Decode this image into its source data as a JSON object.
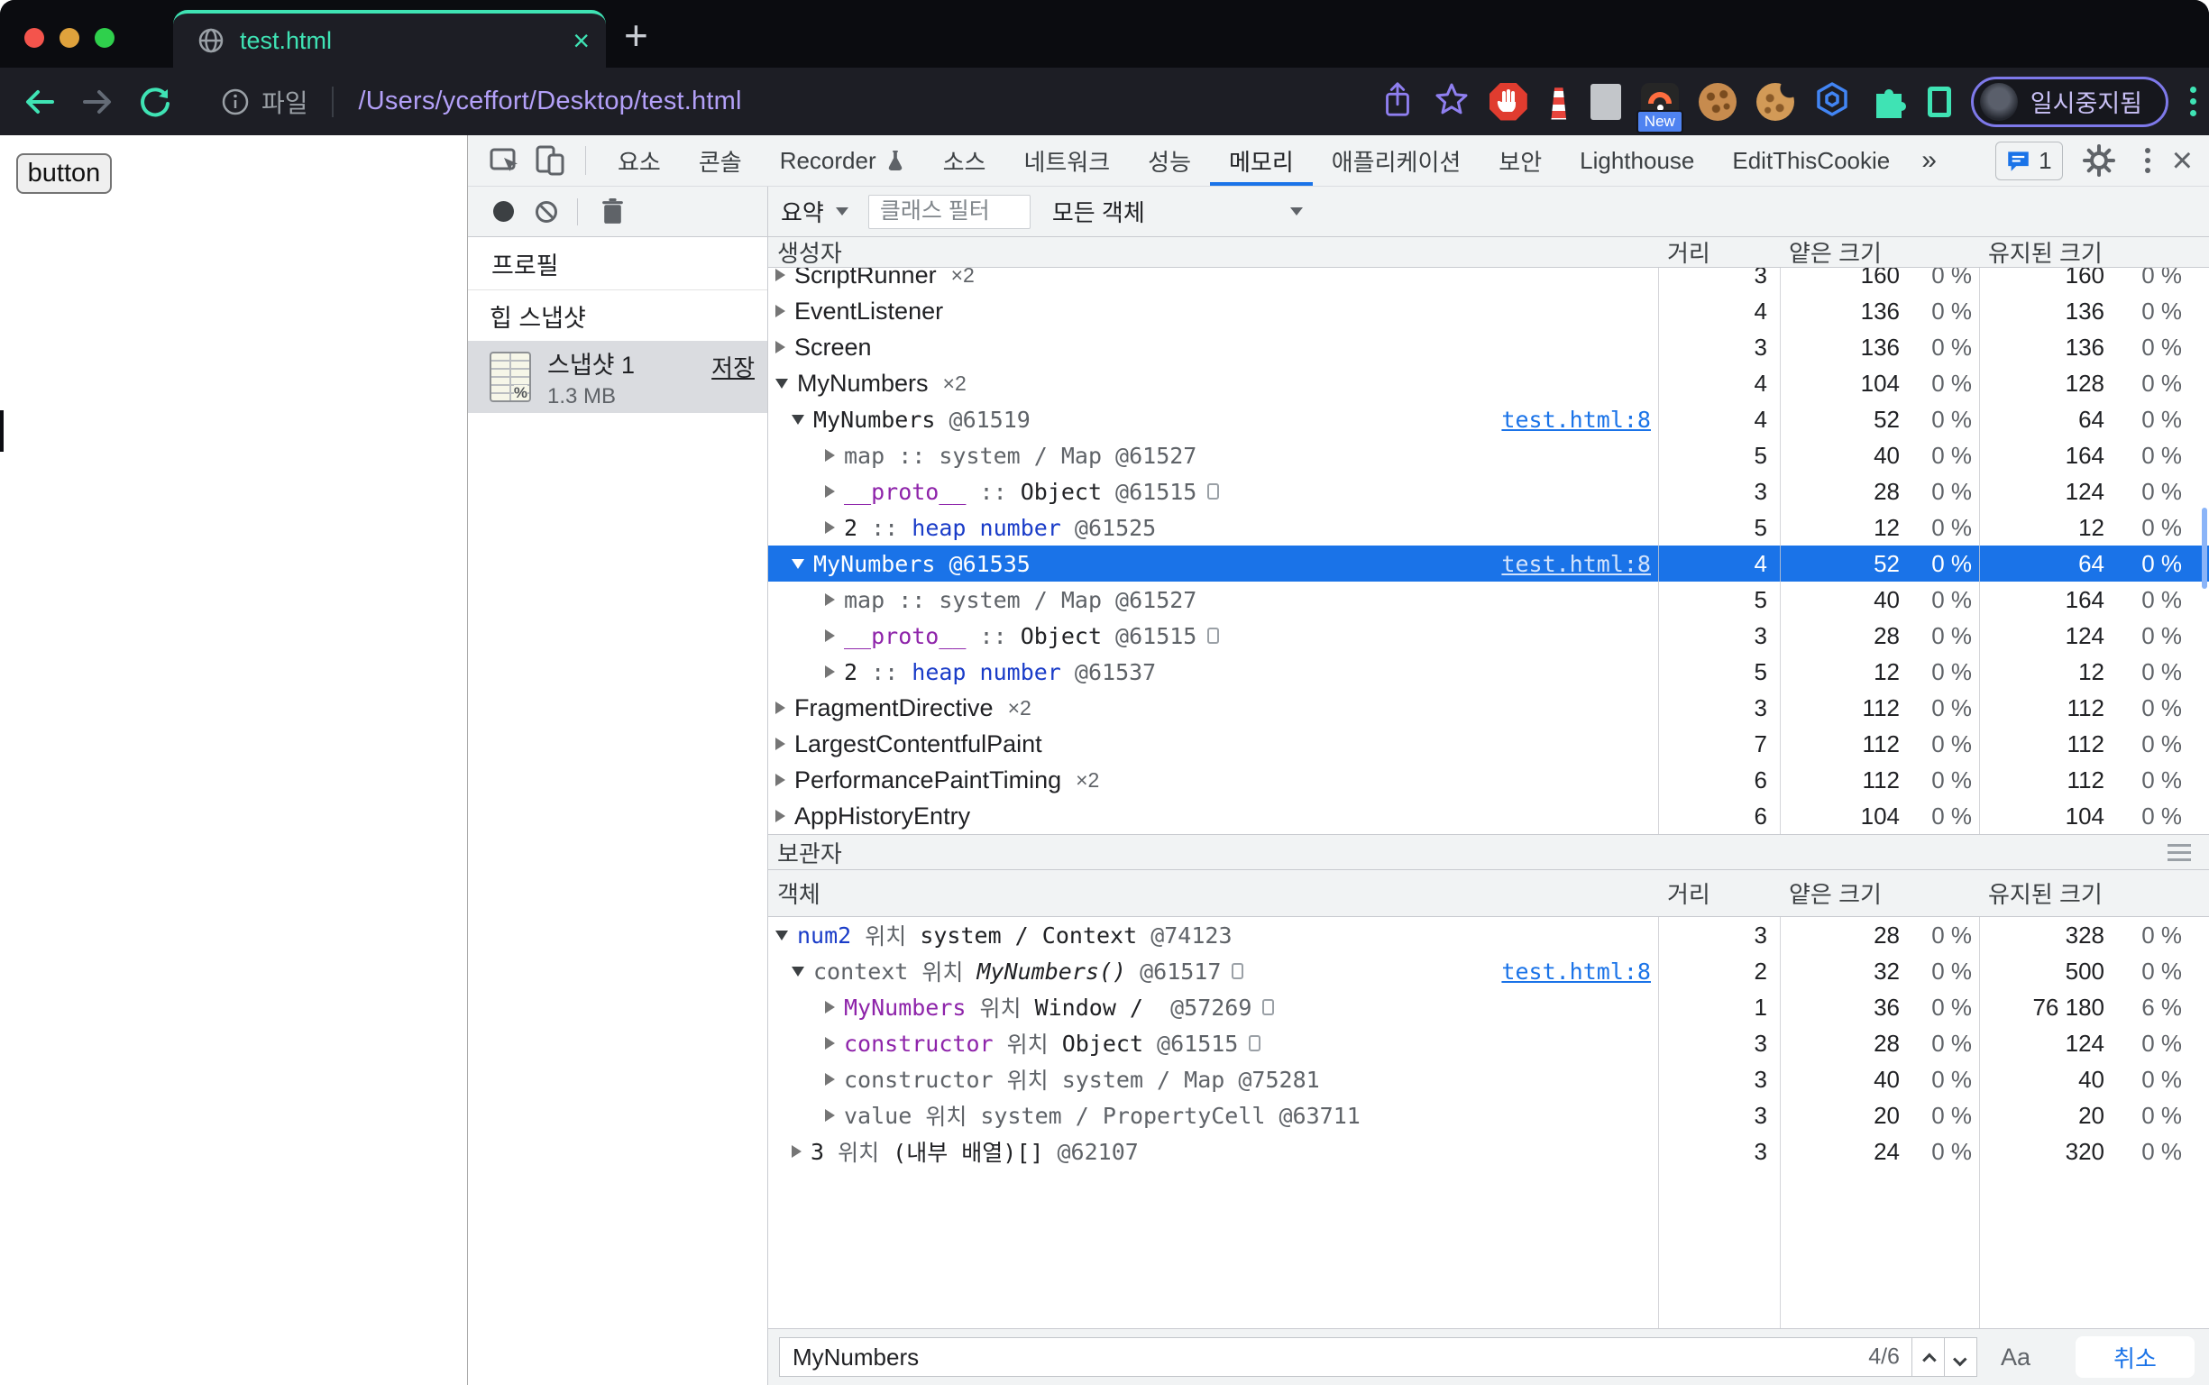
{
  "theme": {
    "accent_blue": "#1a73e8",
    "selection_blue": "#1a73e8",
    "tab_teal": "#3fe3b4",
    "url_purple": "#b3a0f8",
    "token_gray": "#5f6368",
    "token_purple": "#8e24aa",
    "token_blue": "#1a3cc8",
    "token_dark": "#202124"
  },
  "browser": {
    "tab_title": "test.html",
    "file_label": "파일",
    "url": "/Users/yceffort/Desktop/test.html",
    "new_badge": "New",
    "profile_status": "일시중지됨"
  },
  "page": {
    "button_label": "button"
  },
  "devtools": {
    "tabs": [
      "요소",
      "콘솔",
      "Recorder",
      "소스",
      "네트워크",
      "성능",
      "메모리",
      "애플리케이션",
      "보안",
      "Lighthouse",
      "EditThisCookie"
    ],
    "selected_tab": "메모리",
    "more_tabs_label": "»",
    "issues_count": "1",
    "toolbar": {
      "summary_label": "요약",
      "class_filter_placeholder": "클래스 필터",
      "all_objects_label": "모든 객체"
    },
    "sidebar": {
      "profiles_label": "프로필",
      "heap_snapshots_label": "힙 스냅샷",
      "snapshot_name": "스냅샷 1",
      "snapshot_size": "1.3 MB",
      "save_label": "저장"
    },
    "grid": {
      "columns": [
        "생성자",
        "거리",
        "얕은 크기",
        "유지된 크기"
      ],
      "rows": [
        {
          "clip": true,
          "lvl": 0,
          "arrow": "r",
          "font": "sans",
          "segs": [
            {
              "t": "ScriptRunner",
              "c": "d"
            }
          ],
          "count": "×2",
          "dist": "3",
          "shallow": "160",
          "shallow_pct": "0 %",
          "retained": "160",
          "retained_pct": "0 %"
        },
        {
          "lvl": 0,
          "arrow": "r",
          "font": "sans",
          "segs": [
            {
              "t": "EventListener",
              "c": "d"
            }
          ],
          "dist": "4",
          "shallow": "136",
          "shallow_pct": "0 %",
          "retained": "136",
          "retained_pct": "0 %"
        },
        {
          "lvl": 0,
          "arrow": "r",
          "font": "sans",
          "segs": [
            {
              "t": "Screen",
              "c": "d"
            }
          ],
          "dist": "3",
          "shallow": "136",
          "shallow_pct": "0 %",
          "retained": "136",
          "retained_pct": "0 %"
        },
        {
          "lvl": 0,
          "arrow": "v",
          "font": "sans",
          "segs": [
            {
              "t": "MyNumbers",
              "c": "d"
            }
          ],
          "count": "×2",
          "dist": "4",
          "shallow": "104",
          "shallow_pct": "0 %",
          "retained": "128",
          "retained_pct": "0 %"
        },
        {
          "lvl": 1,
          "arrow": "v",
          "font": "mono",
          "segs": [
            {
              "t": "MyNumbers ",
              "c": "d"
            },
            {
              "t": "@61519",
              "c": "g"
            }
          ],
          "link": "test.html:8",
          "dist": "4",
          "shallow": "52",
          "shallow_pct": "0 %",
          "retained": "64",
          "retained_pct": "0 %"
        },
        {
          "lvl": 2,
          "arrow": "r",
          "font": "mono",
          "segs": [
            {
              "t": "map",
              "c": "g"
            },
            {
              "t": " :: ",
              "c": "g"
            },
            {
              "t": "system / Map",
              "c": "g"
            },
            {
              "t": " @61527",
              "c": "g"
            }
          ],
          "dist": "5",
          "shallow": "40",
          "shallow_pct": "0 %",
          "retained": "164",
          "retained_pct": "0 %"
        },
        {
          "lvl": 2,
          "arrow": "r",
          "font": "mono",
          "segs": [
            {
              "t": "__proto__",
              "c": "p"
            },
            {
              "t": " :: ",
              "c": "g"
            },
            {
              "t": "Object",
              "c": "d"
            },
            {
              "t": " @61515",
              "c": "g"
            }
          ],
          "box": true,
          "dist": "3",
          "shallow": "28",
          "shallow_pct": "0 %",
          "retained": "124",
          "retained_pct": "0 %"
        },
        {
          "lvl": 2,
          "arrow": "r",
          "font": "mono",
          "segs": [
            {
              "t": "2",
              "c": "d"
            },
            {
              "t": " :: ",
              "c": "g"
            },
            {
              "t": "heap number",
              "c": "b"
            },
            {
              "t": " @61525",
              "c": "g"
            }
          ],
          "dist": "5",
          "shallow": "12",
          "shallow_pct": "0 %",
          "retained": "12",
          "retained_pct": "0 %"
        },
        {
          "sel": true,
          "lvl": 1,
          "arrow": "v",
          "font": "mono",
          "segs": [
            {
              "t": "MyNumbers ",
              "c": "d"
            },
            {
              "t": "@61535",
              "c": "g"
            }
          ],
          "link": "test.html:8",
          "dist": "4",
          "shallow": "52",
          "shallow_pct": "0 %",
          "retained": "64",
          "retained_pct": "0 %"
        },
        {
          "lvl": 2,
          "arrow": "r",
          "font": "mono",
          "segs": [
            {
              "t": "map",
              "c": "g"
            },
            {
              "t": " :: ",
              "c": "g"
            },
            {
              "t": "system / Map",
              "c": "g"
            },
            {
              "t": " @61527",
              "c": "g"
            }
          ],
          "dist": "5",
          "shallow": "40",
          "shallow_pct": "0 %",
          "retained": "164",
          "retained_pct": "0 %"
        },
        {
          "lvl": 2,
          "arrow": "r",
          "font": "mono",
          "segs": [
            {
              "t": "__proto__",
              "c": "p"
            },
            {
              "t": " :: ",
              "c": "g"
            },
            {
              "t": "Object",
              "c": "d"
            },
            {
              "t": " @61515",
              "c": "g"
            }
          ],
          "box": true,
          "dist": "3",
          "shallow": "28",
          "shallow_pct": "0 %",
          "retained": "124",
          "retained_pct": "0 %"
        },
        {
          "lvl": 2,
          "arrow": "r",
          "font": "mono",
          "segs": [
            {
              "t": "2",
              "c": "d"
            },
            {
              "t": " :: ",
              "c": "g"
            },
            {
              "t": "heap number",
              "c": "b"
            },
            {
              "t": " @61537",
              "c": "g"
            }
          ],
          "dist": "5",
          "shallow": "12",
          "shallow_pct": "0 %",
          "retained": "12",
          "retained_pct": "0 %"
        },
        {
          "lvl": 0,
          "arrow": "r",
          "font": "sans",
          "segs": [
            {
              "t": "FragmentDirective",
              "c": "d"
            }
          ],
          "count": "×2",
          "dist": "3",
          "shallow": "112",
          "shallow_pct": "0 %",
          "retained": "112",
          "retained_pct": "0 %"
        },
        {
          "lvl": 0,
          "arrow": "r",
          "font": "sans",
          "segs": [
            {
              "t": "LargestContentfulPaint",
              "c": "d"
            }
          ],
          "dist": "7",
          "shallow": "112",
          "shallow_pct": "0 %",
          "retained": "112",
          "retained_pct": "0 %"
        },
        {
          "lvl": 0,
          "arrow": "r",
          "font": "sans",
          "segs": [
            {
              "t": "PerformancePaintTiming",
              "c": "d"
            }
          ],
          "count": "×2",
          "dist": "6",
          "shallow": "112",
          "shallow_pct": "0 %",
          "retained": "112",
          "retained_pct": "0 %"
        },
        {
          "lvl": 0,
          "arrow": "r",
          "font": "sans",
          "segs": [
            {
              "t": "AppHistoryEntry",
              "c": "d"
            }
          ],
          "dist": "6",
          "shallow": "104",
          "shallow_pct": "0 %",
          "retained": "104",
          "retained_pct": "0 %"
        }
      ]
    },
    "retainers": {
      "title": "보관자",
      "columns": [
        "객체",
        "거리",
        "얕은 크기",
        "유지된 크기"
      ],
      "rows": [
        {
          "lvl": 0,
          "arrow": "v",
          "font": "mono",
          "segs": [
            {
              "t": "num2",
              "c": "b"
            },
            {
              "t": " 위치 ",
              "c": "g"
            },
            {
              "t": "system / Context",
              "c": "d"
            },
            {
              "t": " @74123",
              "c": "g"
            }
          ],
          "dist": "3",
          "shallow": "28",
          "shallow_pct": "0 %",
          "retained": "328",
          "retained_pct": "0 %"
        },
        {
          "lvl": 1,
          "arrow": "v",
          "font": "mono",
          "segs": [
            {
              "t": "context",
              "c": "g"
            },
            {
              "t": " 위치 ",
              "c": "g"
            },
            {
              "t": "MyNumbers()",
              "c": "i"
            },
            {
              "t": " @61517",
              "c": "g"
            }
          ],
          "box": true,
          "link": "test.html:8",
          "dist": "2",
          "shallow": "32",
          "shallow_pct": "0 %",
          "retained": "500",
          "retained_pct": "0 %"
        },
        {
          "lvl": 2,
          "arrow": "r",
          "font": "mono",
          "segs": [
            {
              "t": "MyNumbers",
              "c": "p"
            },
            {
              "t": " 위치 ",
              "c": "g"
            },
            {
              "t": "Window / ",
              "c": "d"
            },
            {
              "t": " @57269",
              "c": "g"
            }
          ],
          "box": true,
          "dist": "1",
          "shallow": "36",
          "shallow_pct": "0 %",
          "retained": "76 180",
          "retained_pct": "6 %"
        },
        {
          "lvl": 2,
          "arrow": "r",
          "font": "mono",
          "segs": [
            {
              "t": "constructor",
              "c": "p"
            },
            {
              "t": " 위치 ",
              "c": "g"
            },
            {
              "t": "Object",
              "c": "d"
            },
            {
              "t": " @61515",
              "c": "g"
            }
          ],
          "box": true,
          "dist": "3",
          "shallow": "28",
          "shallow_pct": "0 %",
          "retained": "124",
          "retained_pct": "0 %"
        },
        {
          "lvl": 2,
          "arrow": "r",
          "font": "mono",
          "segs": [
            {
              "t": "constructor",
              "c": "g"
            },
            {
              "t": " 위치 ",
              "c": "g"
            },
            {
              "t": "system / Map",
              "c": "g"
            },
            {
              "t": " @75281",
              "c": "g"
            }
          ],
          "dist": "3",
          "shallow": "40",
          "shallow_pct": "0 %",
          "retained": "40",
          "retained_pct": "0 %"
        },
        {
          "lvl": 2,
          "arrow": "r",
          "font": "mono",
          "segs": [
            {
              "t": "value",
              "c": "g"
            },
            {
              "t": " 위치 ",
              "c": "g"
            },
            {
              "t": "system / PropertyCell",
              "c": "g"
            },
            {
              "t": " @63711",
              "c": "g"
            }
          ],
          "dist": "3",
          "shallow": "20",
          "shallow_pct": "0 %",
          "retained": "20",
          "retained_pct": "0 %"
        },
        {
          "lvl": 1,
          "arrow": "r",
          "font": "mono",
          "segs": [
            {
              "t": "3",
              "c": "d"
            },
            {
              "t": " 위치 ",
              "c": "g"
            },
            {
              "t": "(내부 배열)[]",
              "c": "d"
            },
            {
              "t": " @62107",
              "c": "g"
            }
          ],
          "dist": "3",
          "shallow": "24",
          "shallow_pct": "0 %",
          "retained": "320",
          "retained_pct": "0 %"
        }
      ]
    },
    "search": {
      "query": "MyNumbers",
      "match_position": "4/6",
      "case_label": "Aa",
      "cancel_label": "취소"
    }
  }
}
